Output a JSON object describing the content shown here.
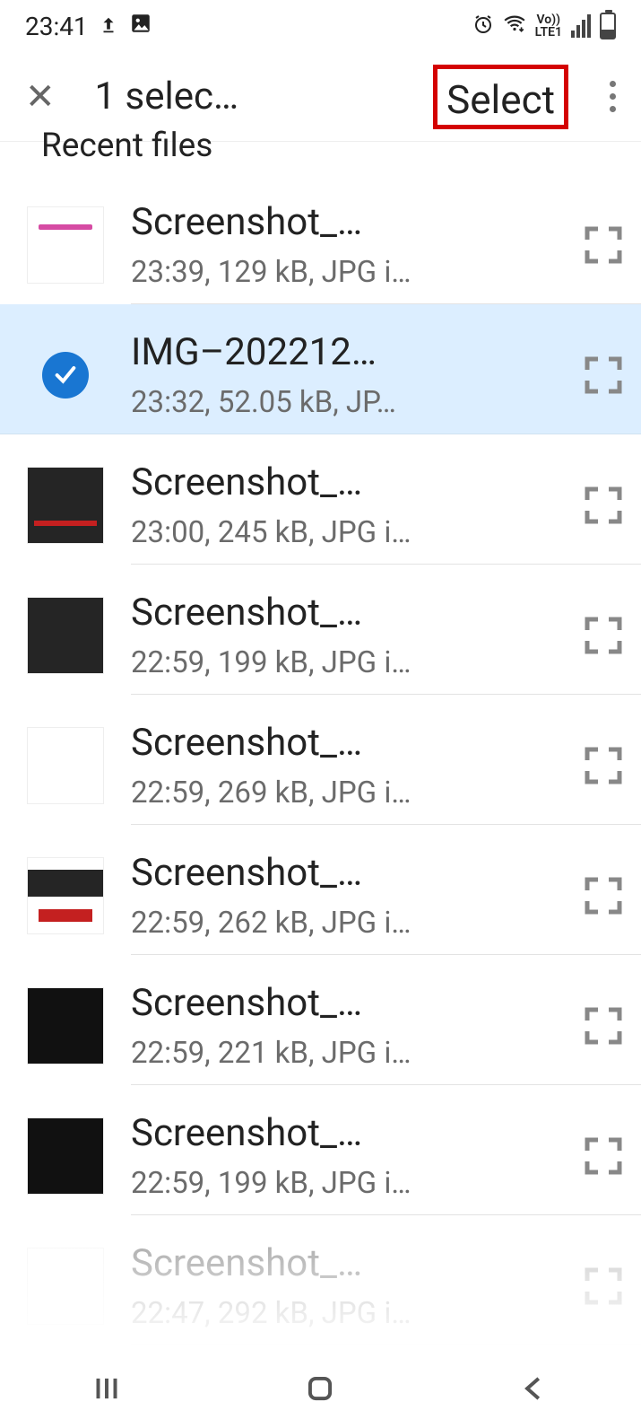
{
  "status": {
    "time": "23:41",
    "network_label": "LTE1",
    "vo_label": "Vo))"
  },
  "appbar": {
    "title": "1 selec…",
    "select_label": "Select"
  },
  "section": {
    "title": "Recent files"
  },
  "files": [
    {
      "name": "Screenshot_…",
      "meta": "23:39, 129 kB, JPG i…",
      "selected": false,
      "thumb": "banner"
    },
    {
      "name": "IMG–202212…",
      "meta": "23:32, 52.05 kB, JP…",
      "selected": true,
      "thumb": "check"
    },
    {
      "name": "Screenshot_…",
      "meta": "23:00, 245 kB, JPG i…",
      "selected": false,
      "thumb": "redstrip"
    },
    {
      "name": "Screenshot_…",
      "meta": "22:59, 199 kB, JPG i…",
      "selected": false,
      "thumb": "dark"
    },
    {
      "name": "Screenshot_…",
      "meta": "22:59, 269 kB, JPG i…",
      "selected": false,
      "thumb": "multi"
    },
    {
      "name": "Screenshot_…",
      "meta": "22:59, 262 kB, JPG i…",
      "selected": false,
      "thumb": "r2"
    },
    {
      "name": "Screenshot_…",
      "meta": "22:59, 221 kB, JPG i…",
      "selected": false,
      "thumb": "darker"
    },
    {
      "name": "Screenshot_…",
      "meta": "22:59, 199 kB, JPG i…",
      "selected": false,
      "thumb": "darker"
    },
    {
      "name": "Screenshot_…",
      "meta": "22:47, 292 kB, JPG i…",
      "selected": false,
      "thumb": "multi",
      "partial": true
    }
  ]
}
